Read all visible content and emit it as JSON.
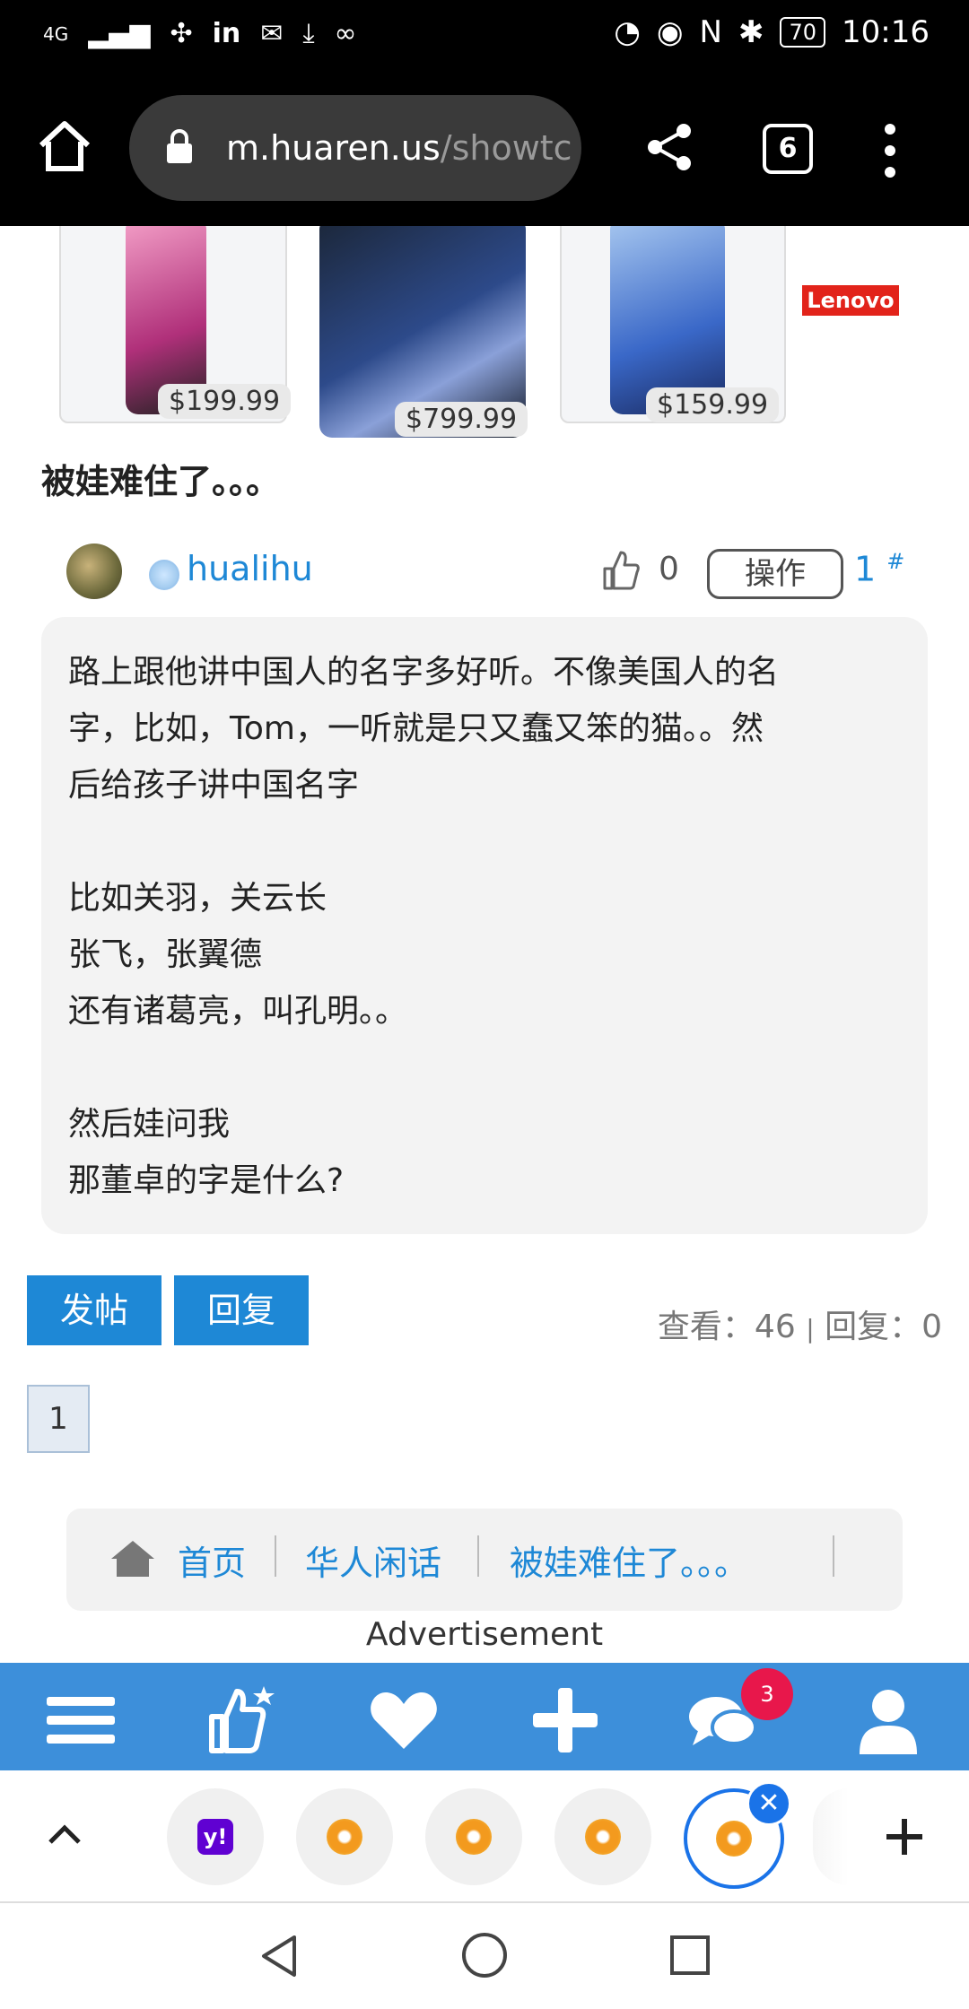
{
  "status_bar": {
    "network": "4G",
    "battery": "70",
    "time": "10:16"
  },
  "browser": {
    "url_host": "m.huaren.us",
    "url_path": "/showtc",
    "tab_count": "6"
  },
  "ad": {
    "prices": [
      "$199.99",
      "$799.99",
      "$159.99"
    ],
    "brand": "Lenovo"
  },
  "thread": {
    "title": "被娃难住了。。。"
  },
  "post": {
    "username": "hualihu",
    "likes": "0",
    "action_label": "操作",
    "floor": "1",
    "floor_mark": "#",
    "lines": [
      "路上跟他讲中国人的名字多好听。不像美国人的名",
      "字，比如，Tom，一听就是只又蠢又笨的猫。。然",
      "后给孩子讲中国名字",
      "",
      "比如关羽，关云长",
      "张飞，张翼德",
      "还有诸葛亮，叫孔明。。",
      "",
      "然后娃问我",
      "那董卓的字是什么?"
    ]
  },
  "actions": {
    "new_post": "发帖",
    "reply": "回复"
  },
  "stats": {
    "views_label": "查看：",
    "views": "46",
    "sep": "|",
    "replies_label": "回复：",
    "replies": "0"
  },
  "pagination": {
    "current": "1"
  },
  "breadcrumb": {
    "items": [
      "首页",
      "华人闲话",
      "被娃难住了。。。"
    ]
  },
  "ad_label": "Advertisement",
  "bottom_nav": {
    "messages_badge": "3"
  },
  "colors": {
    "accent": "#1e88d6",
    "nav_bg": "#3d8fda",
    "badge": "#e8174b"
  }
}
